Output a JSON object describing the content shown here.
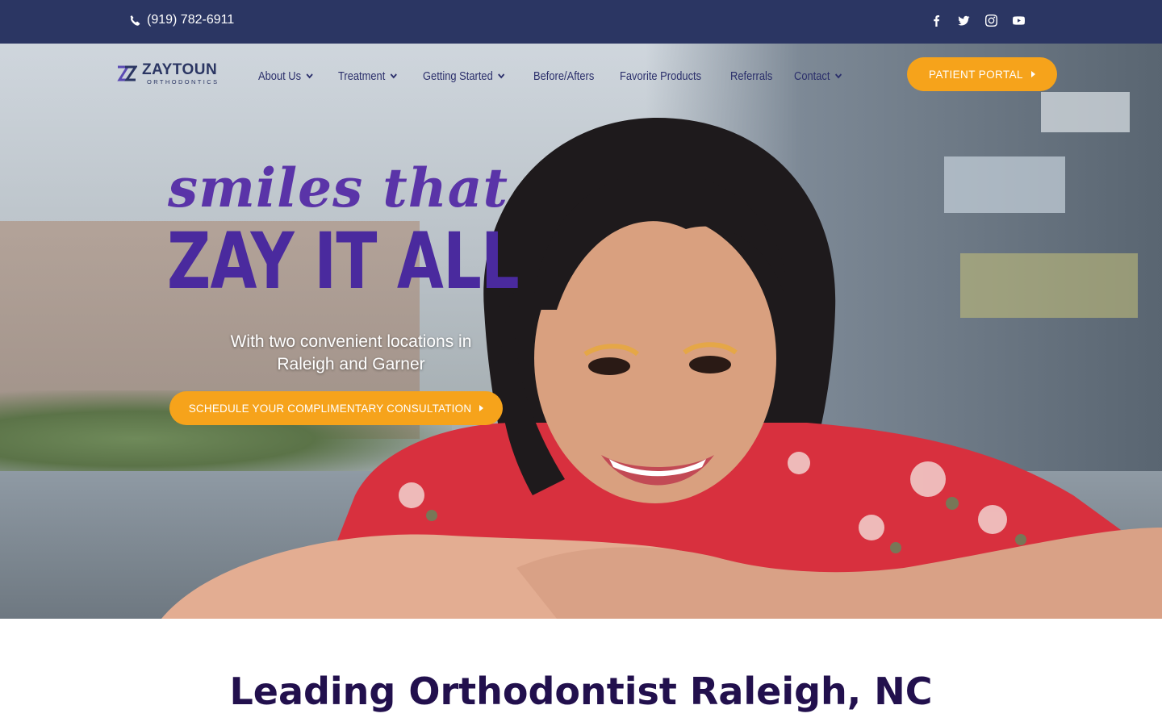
{
  "topbar": {
    "phone": "(919) 782-6911",
    "social": [
      {
        "icon": "facebook-icon"
      },
      {
        "icon": "twitter-icon"
      },
      {
        "icon": "instagram-icon"
      },
      {
        "icon": "youtube-icon"
      }
    ]
  },
  "header": {
    "logo": {
      "name": "ZAYTOUN",
      "sub": "ORTHODONTICS"
    },
    "nav": [
      {
        "label": "About Us",
        "dropdown": true
      },
      {
        "label": "Treatment",
        "dropdown": true
      },
      {
        "label": "Getting Started",
        "dropdown": true
      },
      {
        "label": "Before/Afters",
        "dropdown": false
      },
      {
        "label": "Favorite Products",
        "dropdown": false
      },
      {
        "label": "Referrals",
        "dropdown": false
      },
      {
        "label": "Contact",
        "dropdown": true
      }
    ],
    "portal_button": "PATIENT PORTAL"
  },
  "hero": {
    "script_line": "smiles that",
    "big_line": "ZAY IT ALL",
    "subtitle_line1": "With two convenient locations in",
    "subtitle_line2": "Raleigh and Garner",
    "cta": "SCHEDULE YOUR COMPLIMENTARY CONSULTATION"
  },
  "section": {
    "title": "Leading Orthodontist Raleigh, NC"
  },
  "colors": {
    "topbar": "#2b3663",
    "accent": "#f6a31b",
    "headline_purple": "#4a2a9e",
    "nav_text": "#2b2f6b",
    "section_title": "#22104d"
  }
}
